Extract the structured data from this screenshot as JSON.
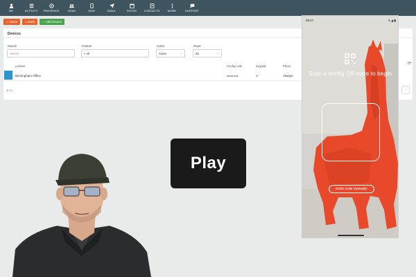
{
  "nav": {
    "items": [
      {
        "label": "ME",
        "icon": "user-icon"
      },
      {
        "label": "ACTIVITY",
        "icon": "activity-icon"
      },
      {
        "label": "PRESENCE",
        "icon": "presence-icon"
      },
      {
        "label": "TEAM",
        "icon": "team-icon"
      },
      {
        "label": "SMS",
        "icon": "sms-icon"
      },
      {
        "label": "EMAIL",
        "icon": "email-icon"
      },
      {
        "label": "ROTAS",
        "icon": "rotas-icon"
      },
      {
        "label": "CONTACTS",
        "icon": "contacts-icon"
      },
      {
        "label": "MORE",
        "icon": "more-icon"
      },
      {
        "label": "SUPPORT",
        "icon": "support-icon"
      }
    ]
  },
  "toolbar": {
    "home_label": "Home",
    "back_label": "Back",
    "add_device_label": "Add Device"
  },
  "devices": {
    "title": "Devices",
    "filters": {
      "search_label": "Search",
      "search_placeholder": "Search",
      "feature_label": "Feature",
      "feature_value": "All",
      "active_label": "Active",
      "active_value": "Active",
      "rows_label": "Rows",
      "rows_value": "25"
    },
    "columns": [
      "Name",
      "Config code",
      "Keypad",
      "Photo"
    ],
    "rows": [
      {
        "name": "Birmingham Office",
        "config_code": "mrk8 kr4t",
        "keypad": "✔",
        "photo": "Always"
      }
    ],
    "pager": "1 / 1",
    "pager_next": "›"
  },
  "phone": {
    "status_time": "09:27",
    "status_right": "▾ ◢ ▮",
    "scan_text": "Scan a config QR code to begin.",
    "manual_button": "Enter code manually"
  },
  "video": {
    "play_label": "Play"
  },
  "colors": {
    "nav_bg": "#3e5560",
    "orange": "#e8622c",
    "green": "#4aa44f",
    "row_icon": "#2a96d1",
    "llama": "#e8492a"
  }
}
